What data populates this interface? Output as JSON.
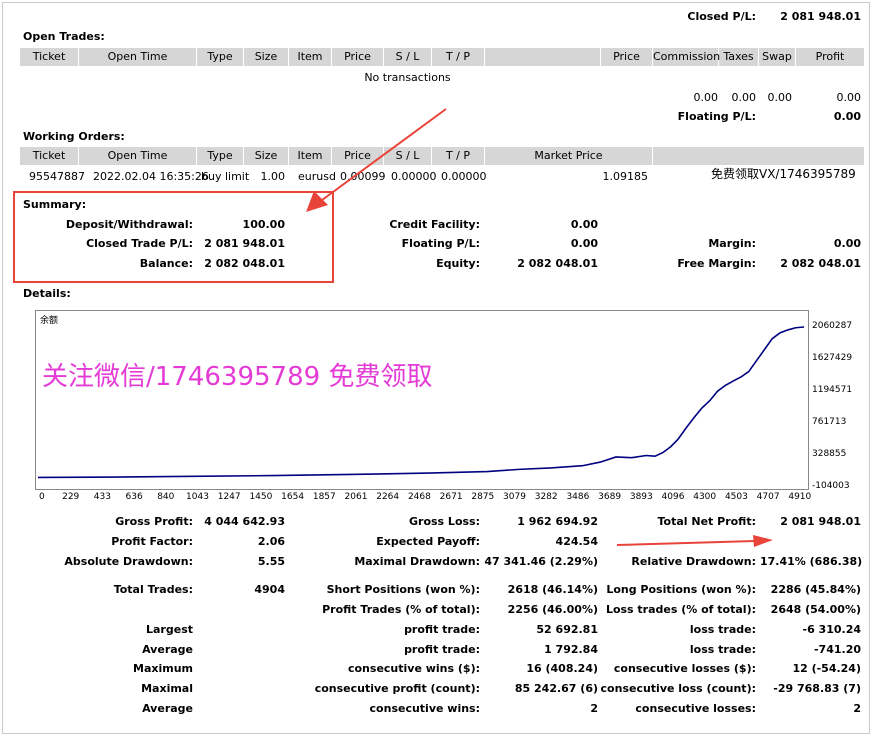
{
  "header": {
    "closed_pl_label": "Closed P/L:",
    "closed_pl_value": "2 081 948.01"
  },
  "open_trades": {
    "title": "Open Trades:",
    "columns": [
      "Ticket",
      "Open Time",
      "Type",
      "Size",
      "Item",
      "Price",
      "S / L",
      "T / P",
      "",
      "Price",
      "Commission",
      "Taxes",
      "Swap",
      "Profit"
    ],
    "empty_text": "No transactions",
    "totals": {
      "commission": "0.00",
      "taxes": "0.00",
      "swap": "0.00",
      "profit": "0.00"
    },
    "floating_label": "Floating P/L:",
    "floating_value": "0.00"
  },
  "working_orders": {
    "title": "Working Orders:",
    "columns": [
      "Ticket",
      "Open Time",
      "Type",
      "Size",
      "Item",
      "Price",
      "S / L",
      "T / P",
      "Market Price",
      ""
    ],
    "row": {
      "ticket": "95547887",
      "open_time": "2022.02.04 16:35:26",
      "type": "buy limit",
      "size": "1.00",
      "item": "eurusd",
      "price": "0.00099",
      "sl": "0.00000",
      "tp": "0.00000",
      "market_price": "1.09185",
      "note": "免费领取VX/1746395789"
    }
  },
  "summary": {
    "title": "Summary:",
    "deposit_label": "Deposit/Withdrawal:",
    "deposit_value": "100.00",
    "credit_label": "Credit Facility:",
    "credit_value": "0.00",
    "closed_label": "Closed Trade P/L:",
    "closed_value": "2 081 948.01",
    "floating_label": "Floating P/L:",
    "floating_value": "0.00",
    "margin_label": "Margin:",
    "margin_value": "0.00",
    "balance_label": "Balance:",
    "balance_value": "2 082 048.01",
    "equity_label": "Equity:",
    "equity_value": "2 082 048.01",
    "free_margin_label": "Free Margin:",
    "free_margin_value": "2 082 048.01"
  },
  "details": {
    "title": "Details:"
  },
  "watermark": "关注微信/1746395789  免费领取",
  "chart_data": {
    "type": "line",
    "series_label": "余额",
    "x_ticks": [
      "0",
      "229",
      "433",
      "636",
      "840",
      "1043",
      "1247",
      "1450",
      "1654",
      "1857",
      "2061",
      "2264",
      "2468",
      "2671",
      "2875",
      "3079",
      "3282",
      "3486",
      "3689",
      "3893",
      "4096",
      "4300",
      "4503",
      "4707",
      "4910"
    ],
    "y_ticks": [
      "2060287",
      "1627429",
      "1194571",
      "761713",
      "328855",
      "-104003"
    ],
    "ylim": [
      -104003,
      2060287
    ],
    "xlim": [
      0,
      4904
    ],
    "points": [
      [
        0,
        0
      ],
      [
        500,
        5
      ],
      [
        1000,
        15
      ],
      [
        1500,
        25
      ],
      [
        2000,
        40
      ],
      [
        2500,
        60
      ],
      [
        2875,
        80
      ],
      [
        3079,
        110
      ],
      [
        3282,
        130
      ],
      [
        3486,
        160
      ],
      [
        3600,
        210
      ],
      [
        3700,
        280
      ],
      [
        3800,
        270
      ],
      [
        3893,
        300
      ],
      [
        3950,
        290
      ],
      [
        4000,
        340
      ],
      [
        4050,
        420
      ],
      [
        4096,
        520
      ],
      [
        4150,
        680
      ],
      [
        4200,
        820
      ],
      [
        4250,
        950
      ],
      [
        4300,
        1050
      ],
      [
        4350,
        1180
      ],
      [
        4400,
        1260
      ],
      [
        4450,
        1320
      ],
      [
        4503,
        1380
      ],
      [
        4550,
        1450
      ],
      [
        4600,
        1600
      ],
      [
        4650,
        1750
      ],
      [
        4700,
        1900
      ],
      [
        4750,
        1980
      ],
      [
        4800,
        2020
      ],
      [
        4850,
        2050
      ],
      [
        4904,
        2060
      ]
    ]
  },
  "stats": {
    "gross_profit_label": "Gross Profit:",
    "gross_profit": "4 044 642.93",
    "gross_loss_label": "Gross Loss:",
    "gross_loss": "1 962 694.92",
    "total_net_label": "Total Net Profit:",
    "total_net": "2 081 948.01",
    "pf_label": "Profit Factor:",
    "pf": "2.06",
    "ep_label": "Expected Payoff:",
    "ep": "424.54",
    "abs_dd_label": "Absolute Drawdown:",
    "abs_dd": "5.55",
    "max_dd_label": "Maximal Drawdown:",
    "max_dd": "47 341.46 (2.29%)",
    "rel_dd_label": "Relative Drawdown:",
    "rel_dd": "17.41% (686.38)",
    "trades_label": "Total Trades:",
    "trades": "4904",
    "short_label": "Short Positions (won %):",
    "short": "2618 (46.14%)",
    "long_label": "Long Positions (won %):",
    "long": "2286 (45.84%)",
    "profit_trades_label": "Profit Trades (% of total):",
    "profit_trades": "2256 (46.00%)",
    "loss_trades_label": "Loss trades (% of total):",
    "loss_trades": "2648 (54.00%)",
    "largest_label": "Largest",
    "largest_pt_label": "profit trade:",
    "largest_pt": "52 692.81",
    "largest_lt_label": "loss trade:",
    "largest_lt": "-6 310.24",
    "average_label": "Average",
    "avg_pt_label": "profit trade:",
    "avg_pt": "1 792.84",
    "avg_lt_label": "loss trade:",
    "avg_lt": "-741.20",
    "maximum_label": "Maximum",
    "max_cw_label": "consecutive wins ($):",
    "max_cw": "16 (408.24)",
    "max_cl_label": "consecutive losses ($):",
    "max_cl": "12 (-54.24)",
    "maximal_label": "Maximal",
    "mx_cp_label": "consecutive profit (count):",
    "mx_cp": "85 242.67 (6)",
    "mx_cl_label": "consecutive loss (count):",
    "mx_cl": "-29 768.83 (7)",
    "average2_label": "Average",
    "avg_cw_label": "consecutive wins:",
    "avg_cw": "2",
    "avg_cl_label": "consecutive losses:",
    "avg_cl": "2"
  }
}
